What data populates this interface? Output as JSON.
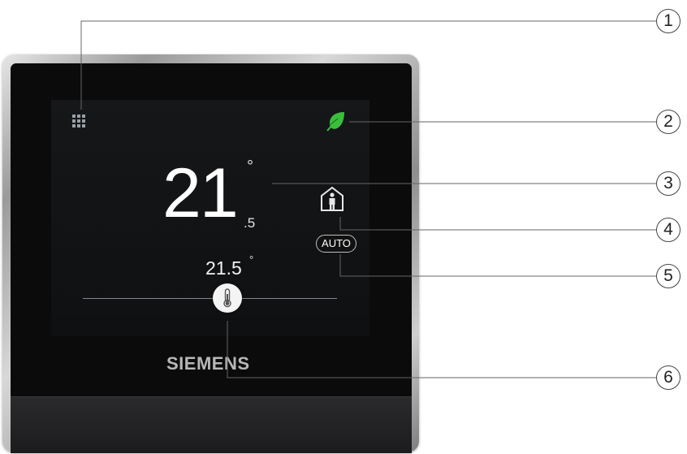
{
  "device": {
    "brand": "SIEMENS",
    "current_temp_integer": "21",
    "current_temp_decimal": ".5",
    "current_temp_degree": "°",
    "setpoint_value": "21.5",
    "setpoint_degree": "°",
    "mode_label": "AUTO"
  },
  "callouts": [
    "1",
    "2",
    "3",
    "4",
    "5",
    "6"
  ],
  "colors": {
    "leaf": "#3bbf3b",
    "screen": "#121416",
    "bezel": "#a8a8a8"
  },
  "icons": [
    "menu-grid-icon",
    "eco-leaf-icon",
    "home-presence-icon",
    "thermometer-icon"
  ]
}
